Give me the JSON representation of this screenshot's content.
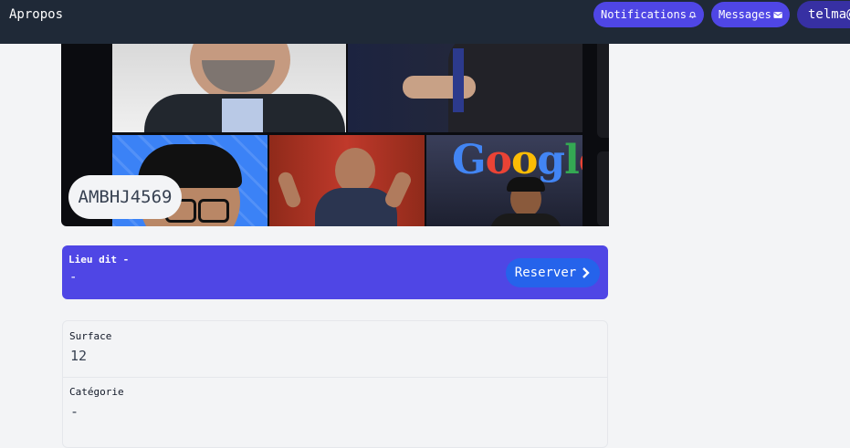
{
  "header": {
    "brand": "Apropos",
    "notifications_label": "Notifications",
    "messages_label": "Messages",
    "user_label": "telma@"
  },
  "listing": {
    "code": "AMBHJ4569"
  },
  "location": {
    "label": "Lieu dit -",
    "value": "-",
    "reserve_label": "Reserver"
  },
  "details": {
    "surface_label": "Surface",
    "surface_value": "12",
    "category_label": "Catégorie",
    "category_value": "-"
  },
  "colors": {
    "topbar": "#1f2937",
    "accent": "#4f46e5",
    "button": "#2563eb",
    "background": "#f3f4f6"
  },
  "icons": {
    "notifications": "bell-icon",
    "messages": "envelope-icon",
    "reserve": "chevron-right-icon"
  }
}
